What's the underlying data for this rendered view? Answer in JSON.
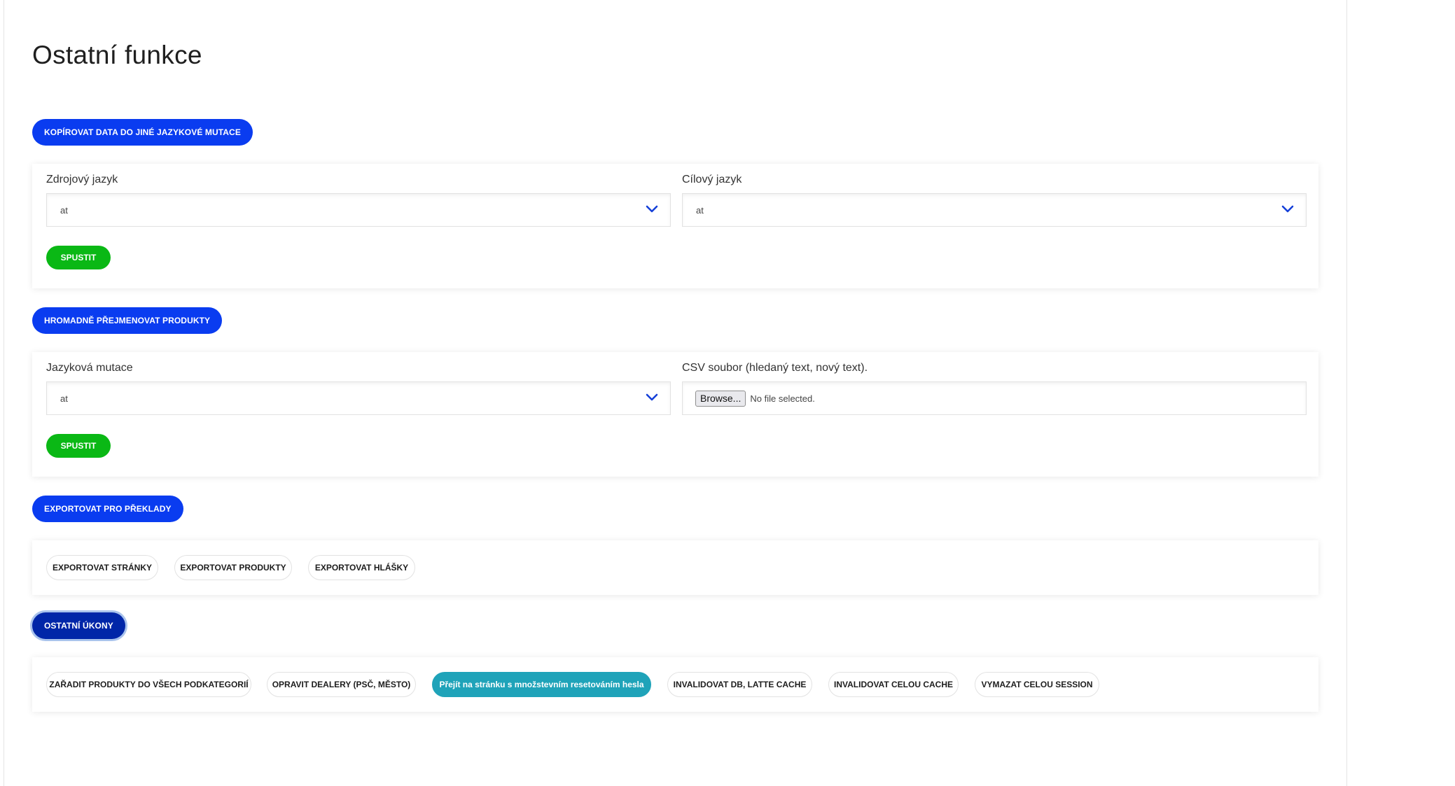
{
  "page": {
    "title": "Ostatní funkce"
  },
  "sections": {
    "copy": {
      "header": "KOPÍROVAT DATA DO JINÉ JAZYKOVÉ MUTACE",
      "source_label": "Zdrojový jazyk",
      "source_value": "at",
      "target_label": "Cílový jazyk",
      "target_value": "at",
      "run_label": "SPUSTIT"
    },
    "rename": {
      "header": "HROMADNĚ PŘEJMENOVAT PRODUKTY",
      "language_label": "Jazyková mutace",
      "language_value": "at",
      "csv_label": "CSV soubor (hledaný text, nový text).",
      "browse_label": "Browse...",
      "file_status": "No file selected.",
      "run_label": "SPUSTIT"
    },
    "export": {
      "header": "EXPORTOVAT PRO PŘEKLADY",
      "buttons": [
        "EXPORTOVAT STRÁNKY",
        "EXPORTOVAT PRODUKTY",
        "EXPORTOVAT HLÁŠKY"
      ]
    },
    "other": {
      "header": "OSTATNÍ ÚKONY",
      "buttons": [
        "ZAŘADIT PRODUKTY DO VŠECH PODKATEGORIÍ",
        "OPRAVIT DEALERY (PSČ, MĚSTO)",
        "Přejít na stránku s množstevním resetováním hesla",
        "INVALIDOVAT DB, LATTE CACHE",
        "INVALIDOVAT CELOU CACHE",
        "VYMAZAT CELOU SESSION"
      ]
    }
  },
  "colors": {
    "header_blue": "#0a3cf0",
    "header_active": "#0026a8",
    "run_green": "#0ab815",
    "teal_button": "#1fa3b9",
    "chevron": "#1540d8"
  },
  "icons": {
    "select_arrow": "chevron-down-icon"
  }
}
